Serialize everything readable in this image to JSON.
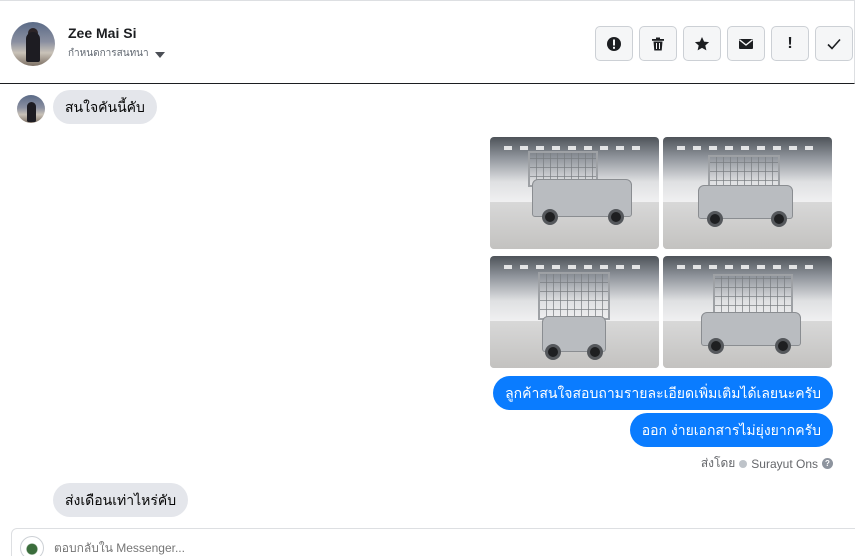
{
  "header": {
    "contact_name": "Zee Mai Si",
    "assign_label": "กำหนดการสนทนา",
    "actions": [
      {
        "name": "report-spam",
        "icon": "alert-circle-icon"
      },
      {
        "name": "delete",
        "icon": "trash-icon"
      },
      {
        "name": "star",
        "icon": "star-icon"
      },
      {
        "name": "mark-unread",
        "icon": "envelope-icon"
      },
      {
        "name": "important",
        "icon": "exclamation-icon",
        "glyph": "!"
      },
      {
        "name": "done",
        "icon": "checkmark-icon",
        "glyph": "✓"
      }
    ]
  },
  "messages": [
    {
      "direction": "in",
      "text": "สนใจคันนี้คับ"
    },
    {
      "direction": "out",
      "type": "photos",
      "count": 4
    },
    {
      "direction": "out",
      "text": "ลูกค้าสนใจสอบถามรายละเอียดเพิ่มเติมได้เลยนะครับ"
    },
    {
      "direction": "out",
      "text": "ออก ง่ายเอกสารไม่ยุ่งยากครับ"
    },
    {
      "direction": "in",
      "text": "ส่งเดือนเท่าไหร่คับ"
    }
  ],
  "sent_by": {
    "prefix": "ส่งโดย",
    "name": "Surayut Ons"
  },
  "reply": {
    "placeholder": "ตอบกลับใน Messenger..."
  },
  "colors": {
    "outgoing_bubble": "#0a7cff",
    "incoming_bubble": "#e4e6eb"
  }
}
